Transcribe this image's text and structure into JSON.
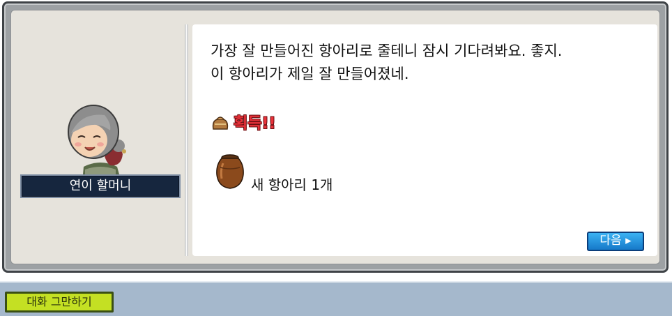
{
  "npc": {
    "name": "연이 할머니"
  },
  "dialog": {
    "line_1": "가장 잘 만들어진 항아리로 줄테니 잠시 기다려봐요. 좋지.",
    "line_2": "이 항아리가 제일 잘 만들어졌네.",
    "obtain_label": "획득!!",
    "item_text": "새 항아리 1개",
    "next_label": "다음 ▸"
  },
  "bottom_bar": {
    "end_chat_label": "대화 그만하기"
  },
  "icons": {
    "portrait": "grandmother-npc-portrait",
    "bag": "bag-icon",
    "item": "clay-jar-icon"
  },
  "colors": {
    "obtain_text": "#e8323a",
    "next_button": "#1e8ad8",
    "end_chat_button": "#c4e023",
    "nameplate": "#16263e",
    "bottom_bar": "#a5b8cc"
  }
}
